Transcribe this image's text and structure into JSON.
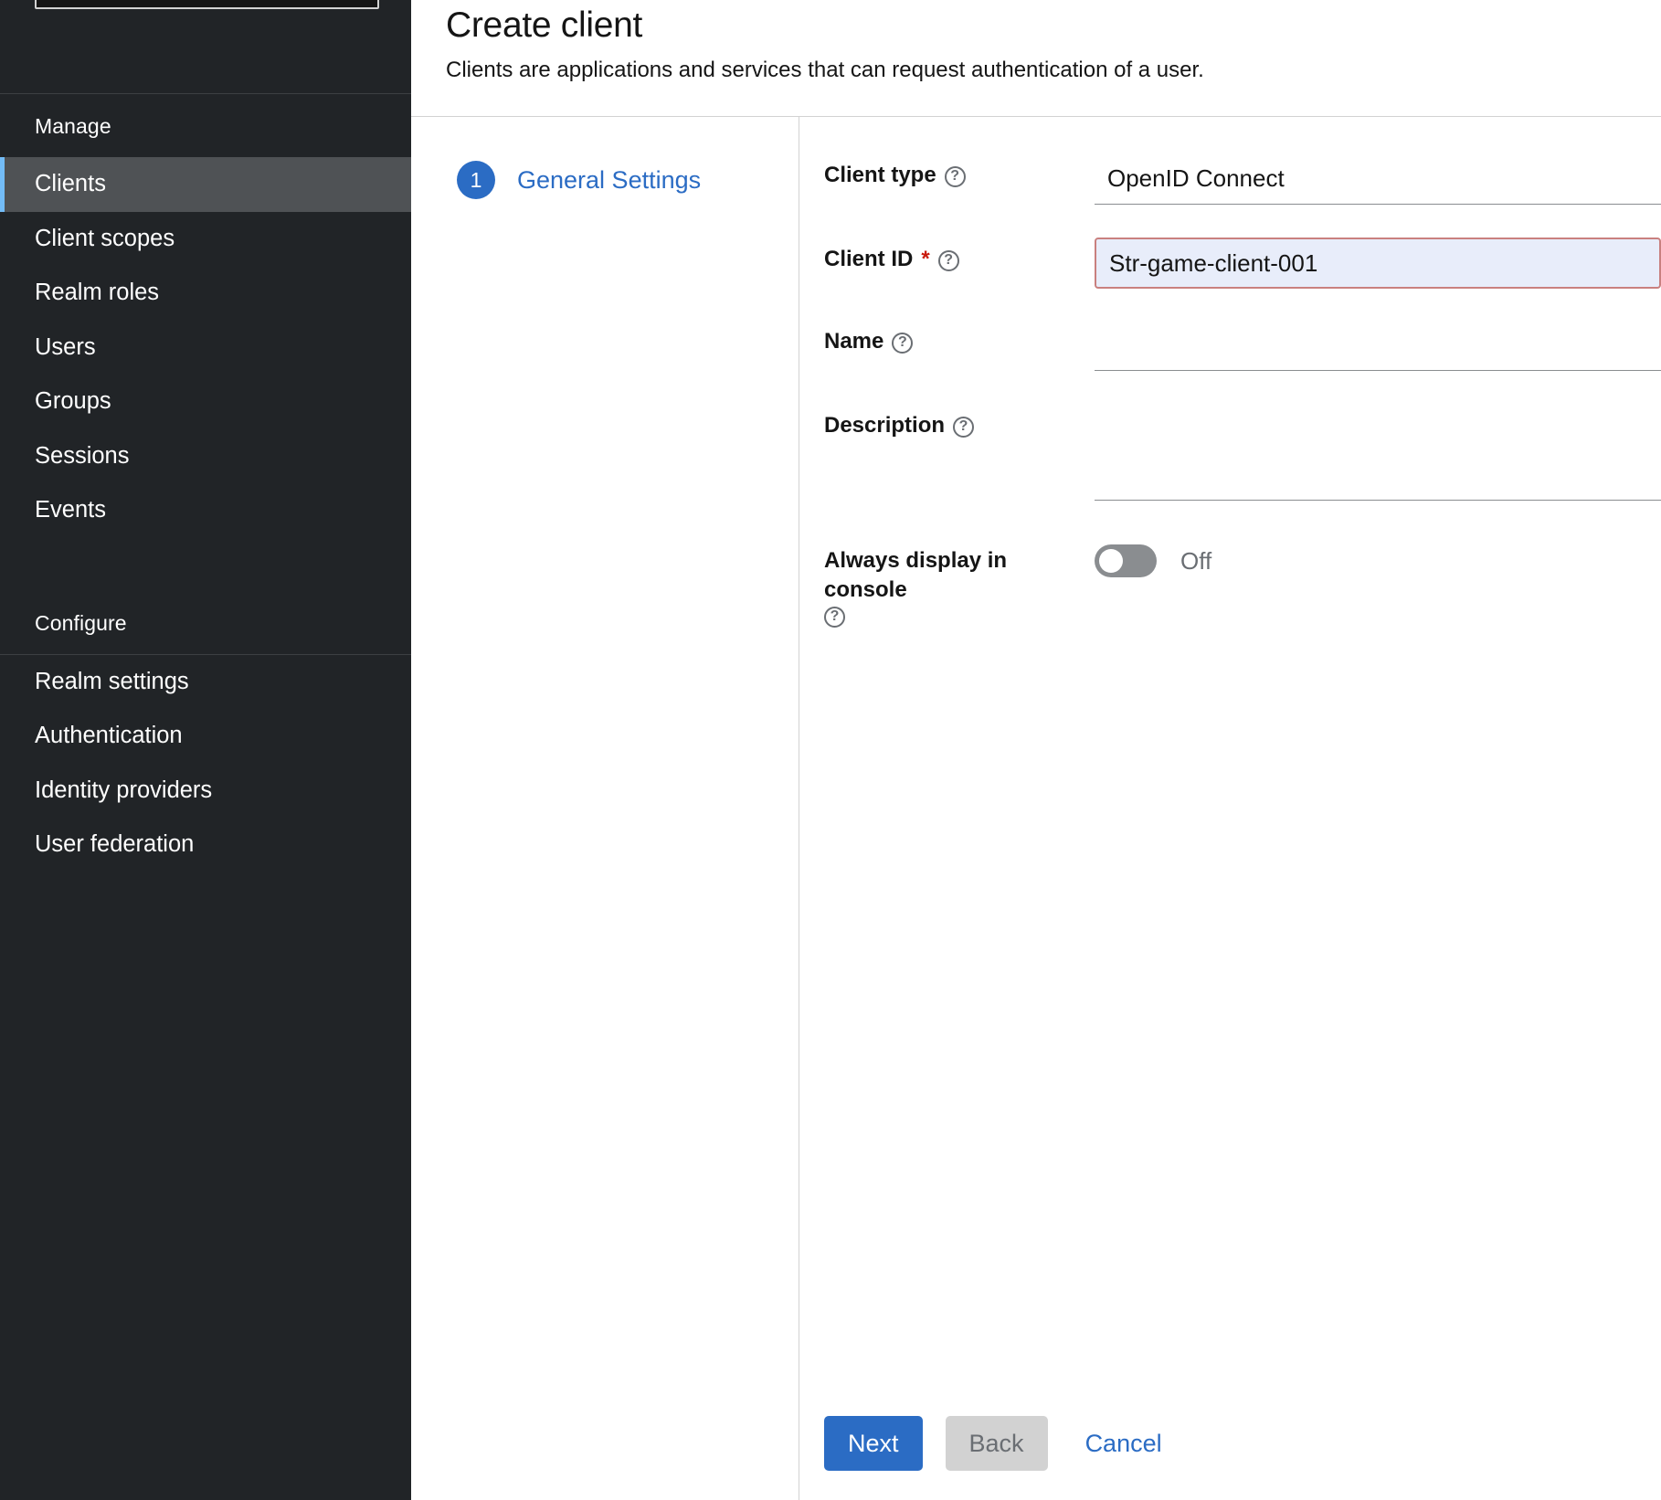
{
  "sidebar": {
    "realm_selector": {
      "name": "realm-selector",
      "value": ""
    },
    "sections": [
      {
        "label": "Manage",
        "items": [
          {
            "label": "Clients",
            "active": true
          },
          {
            "label": "Client scopes",
            "active": false
          },
          {
            "label": "Realm roles",
            "active": false
          },
          {
            "label": "Users",
            "active": false
          },
          {
            "label": "Groups",
            "active": false
          },
          {
            "label": "Sessions",
            "active": false
          },
          {
            "label": "Events",
            "active": false
          }
        ]
      },
      {
        "label": "Configure",
        "items": [
          {
            "label": "Realm settings",
            "active": false
          },
          {
            "label": "Authentication",
            "active": false
          },
          {
            "label": "Identity providers",
            "active": false
          },
          {
            "label": "User federation",
            "active": false
          }
        ]
      }
    ]
  },
  "header": {
    "title": "Create client",
    "subtitle": "Clients are applications and services that can request authentication of a user."
  },
  "wizard": {
    "steps": [
      {
        "number": "1",
        "label": "General Settings"
      }
    ],
    "fields": {
      "client_type": {
        "label": "Client type",
        "help_icon": "question-circle-icon",
        "value": "OpenID Connect",
        "placeholder": ""
      },
      "client_id": {
        "label": "Client ID",
        "required_marker": "*",
        "help_icon": "question-circle-icon",
        "value": "Str-game-client-001",
        "placeholder": "",
        "invalid": true
      },
      "name": {
        "label": "Name",
        "help_icon": "question-circle-icon",
        "value": "",
        "placeholder": ""
      },
      "description": {
        "label": "Description",
        "help_icon": "question-circle-icon",
        "value": "",
        "placeholder": ""
      },
      "always_display": {
        "label": "Always display in console",
        "help_icon": "question-circle-icon",
        "state_label": "Off",
        "on": false
      }
    },
    "footer": {
      "next_label": "Next",
      "back_label": "Back",
      "cancel_label": "Cancel"
    }
  },
  "colors": {
    "accent_blue": "#2b6cc4",
    "sidebar_bg": "#212427",
    "sidebar_active": "#4f5255",
    "active_marker": "#73bcf7",
    "required_red": "#c9190b",
    "invalid_border": "#c9807f",
    "invalid_bg": "#e8edfa",
    "toggle_off": "#8a8d90"
  }
}
